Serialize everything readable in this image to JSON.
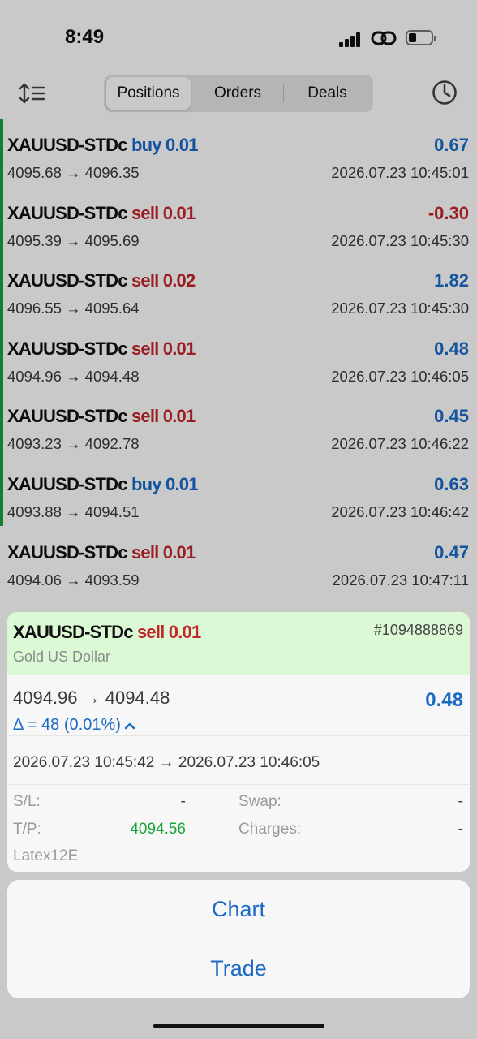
{
  "status_bar": {
    "time": "8:49"
  },
  "tabs": [
    {
      "label": "Positions",
      "active": true
    },
    {
      "label": "Orders",
      "active": false
    },
    {
      "label": "Deals",
      "active": false
    }
  ],
  "positions": [
    {
      "symbol": "XAUUSD-STDc",
      "side": "buy",
      "volume": "0.01",
      "open_price": "4095.68",
      "close_price": "4096.35",
      "profit": "0.67",
      "time": "2026.07.23 10:45:01"
    },
    {
      "symbol": "XAUUSD-STDc",
      "side": "sell",
      "volume": "0.01",
      "open_price": "4095.39",
      "close_price": "4095.69",
      "profit": "-0.30",
      "time": "2026.07.23 10:45:30"
    },
    {
      "symbol": "XAUUSD-STDc",
      "side": "sell",
      "volume": "0.02",
      "open_price": "4096.55",
      "close_price": "4095.64",
      "profit": "1.82",
      "time": "2026.07.23 10:45:30"
    },
    {
      "symbol": "XAUUSD-STDc",
      "side": "sell",
      "volume": "0.01",
      "open_price": "4094.96",
      "close_price": "4094.48",
      "profit": "0.48",
      "time": "2026.07.23 10:46:05"
    },
    {
      "symbol": "XAUUSD-STDc",
      "side": "sell",
      "volume": "0.01",
      "open_price": "4093.23",
      "close_price": "4092.78",
      "profit": "0.45",
      "time": "2026.07.23 10:46:22"
    },
    {
      "symbol": "XAUUSD-STDc",
      "side": "buy",
      "volume": "0.01",
      "open_price": "4093.88",
      "close_price": "4094.51",
      "profit": "0.63",
      "time": "2026.07.23 10:46:42"
    },
    {
      "symbol": "XAUUSD-STDc",
      "side": "sell",
      "volume": "0.01",
      "open_price": "4094.06",
      "close_price": "4093.59",
      "profit": "0.47",
      "time": "2026.07.23 10:47:11"
    }
  ],
  "detail": {
    "symbol": "XAUUSD-STDc",
    "side": "sell",
    "volume": "0.01",
    "ticket": "#1094888869",
    "description": "Gold US Dollar",
    "open_price": "4094.96",
    "close_price": "4094.48",
    "profit": "0.48",
    "delta": "Δ = 48 (0.01%)",
    "open_time": "2026.07.23 10:45:42",
    "close_time": "2026.07.23 10:46:05",
    "arrow": "→",
    "sl_label": "S/L:",
    "sl_value": "-",
    "tp_label": "T/P:",
    "tp_value": "4094.56",
    "swap_label": "Swap:",
    "swap_value": "-",
    "charges_label": "Charges:",
    "charges_value": "-",
    "comment": "Latex12E"
  },
  "actions": {
    "chart": "Chart",
    "trade": "Trade"
  },
  "colors": {
    "buy": "#1a6ac7",
    "sell": "#c3262b",
    "profit_positive": "#1a6ac7",
    "profit_negative": "#c3262b",
    "accent_green": "#1aa33a",
    "header_highlight": "#dcf9d6"
  }
}
